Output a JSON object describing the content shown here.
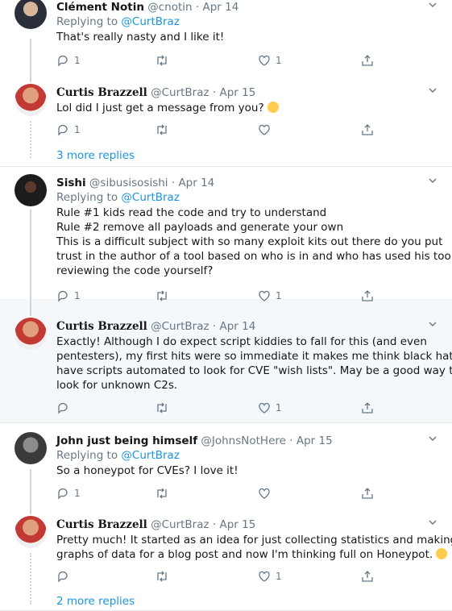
{
  "tweets": [
    {
      "name": "Clément Notin",
      "handle": "@cnotin",
      "date": "Apr 14",
      "replying_label": "Replying to",
      "replying_to": "@CurtBraz",
      "lines": [
        "That's really nasty and I like it!"
      ],
      "reply_count": "1",
      "retweet_count": "",
      "like_count": "1"
    },
    {
      "name": "Curtis Brazzell",
      "handle": "@CurtBraz",
      "date": "Apr 15",
      "lines": [
        "Lol did I just get a message from you?"
      ],
      "emoji": "grinning-squinting-face",
      "reply_count": "1",
      "retweet_count": "",
      "like_count": ""
    },
    {
      "name": "Sishi",
      "handle": "@sibusisosishi",
      "date": "Apr 14",
      "replying_label": "Replying to",
      "replying_to": "@CurtBraz",
      "lines": [
        "Rule #1 kids read the code and try to understand",
        "Rule #2 remove all payloads and generate your own",
        "This is a difficult subject with so many exploit kits out there do you put",
        "trust in the author of a tool based on who is in and who has used his tool or",
        "reviewing the code yourself?"
      ],
      "reply_count": "1",
      "retweet_count": "",
      "like_count": "1"
    },
    {
      "name": "Curtis Brazzell",
      "handle": "@CurtBraz",
      "date": "Apr 14",
      "lines": [
        "Exactly!  Although I do expect script kiddies to fall for this (and even",
        "pentesters), my first hits were so immediate it makes me think black hats",
        "have scripts automated to look for CVE \"wish lists\".  May be a good way to",
        "look for unknown C2s."
      ],
      "reply_count": "",
      "retweet_count": "",
      "like_count": "1"
    },
    {
      "name": "John just being himself",
      "handle": "@JohnsNotHere",
      "date": "Apr 15",
      "replying_label": "Replying to",
      "replying_to": "@CurtBraz",
      "lines": [
        "So a honeypot for CVEs?  I love it!"
      ],
      "reply_count": "1",
      "retweet_count": "",
      "like_count": ""
    },
    {
      "name": "Curtis Brazzell",
      "handle": "@CurtBraz",
      "date": "Apr 15",
      "lines": [
        "Pretty much!  It started as an idea for just collecting statistics and making",
        "graphs of data for a blog post and now I'm thinking full on Honeypot."
      ],
      "emoji": "slightly-smiling-face",
      "reply_count": "",
      "retweet_count": "",
      "like_count": "1"
    }
  ],
  "more_replies_1": "3 more replies",
  "more_replies_2": "2 more replies",
  "dot": "·",
  "colors": {
    "link": "#1b95e0",
    "muted": "#657786",
    "highlight_bg": "#f5f8fa"
  },
  "icons": [
    "reply-icon",
    "retweet-icon",
    "like-icon",
    "share-icon",
    "chevron-down-icon"
  ]
}
